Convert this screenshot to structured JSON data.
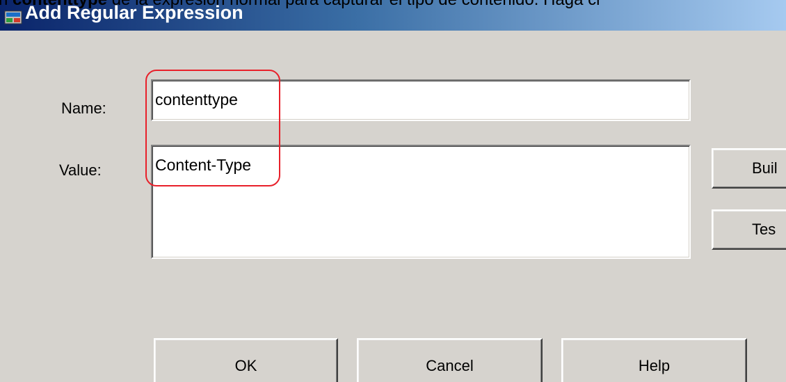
{
  "overflow_caption": {
    "prefix": "n ",
    "bold": "contenttype",
    "suffix": " de la expresión normal para capturar el tipo de contenido. Haga cl"
  },
  "dialog": {
    "title": "Add Regular Expression",
    "icon": "regex-app-icon"
  },
  "form": {
    "name_label": "Name:",
    "name_value": "contenttype",
    "value_label": "Value:",
    "value_value": "Content-Type"
  },
  "side_buttons": {
    "build_label": "Buil",
    "test_label": "Tes"
  },
  "footer": {
    "ok_label": "OK",
    "cancel_label": "Cancel",
    "help_label": "Help"
  },
  "colors": {
    "annotation": "#e8202a",
    "titlebar_dark": "#0a246a",
    "dialog_bg": "#d6d3ce"
  }
}
